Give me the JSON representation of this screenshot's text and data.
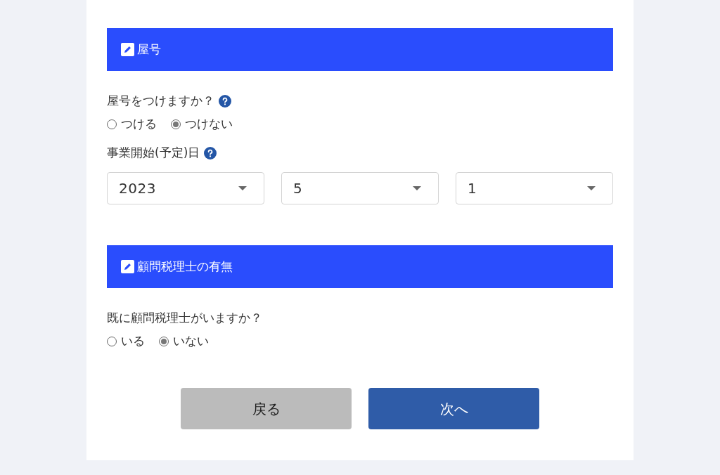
{
  "sections": [
    {
      "title": "屋号",
      "fields": [
        {
          "kind": "radio",
          "label": "屋号をつけますか？",
          "help": true,
          "options": [
            {
              "label": "つける",
              "selected": false
            },
            {
              "label": "つけない",
              "selected": true
            }
          ]
        },
        {
          "kind": "date",
          "label": "事業開始(予定)日",
          "help": true,
          "selects": [
            "2023",
            "5",
            "1"
          ]
        }
      ]
    },
    {
      "title": "顧問税理士の有無",
      "fields": [
        {
          "kind": "radio",
          "label": "既に顧問税理士がいますか？",
          "help": false,
          "options": [
            {
              "label": "いる",
              "selected": false
            },
            {
              "label": "いない",
              "selected": true
            }
          ]
        }
      ]
    }
  ],
  "buttons": [
    {
      "label": "戻る",
      "kind": "back"
    },
    {
      "label": "次へ",
      "kind": "next"
    }
  ]
}
